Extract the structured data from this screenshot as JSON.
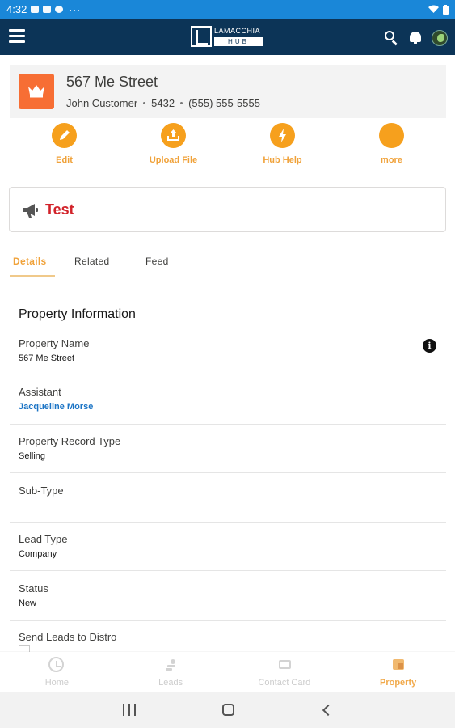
{
  "status_bar": {
    "time": "4:32",
    "overflow": "···"
  },
  "app_bar": {
    "logo_top": "LAMACCHIA",
    "logo_bottom": "HUB",
    "icons": [
      "menu-icon",
      "search-icon",
      "bell-icon",
      "avatar"
    ]
  },
  "record": {
    "title": "567 Me Street",
    "contact": "John Customer",
    "number": "5432",
    "phone": "(555) 555-5555",
    "icon": "crown-icon",
    "icon_color": "#f76e34"
  },
  "actions": [
    {
      "label": "Edit",
      "icon": "pencil-icon"
    },
    {
      "label": "Upload File",
      "icon": "upload-icon"
    },
    {
      "label": "Hub Help",
      "icon": "lightning-icon"
    },
    {
      "label": "more",
      "icon": ""
    }
  ],
  "notice": {
    "text": "Test",
    "icon": "megaphone-icon",
    "color": "#d2232a"
  },
  "tabs": [
    {
      "label": "Details",
      "active": true
    },
    {
      "label": "Related",
      "active": false
    },
    {
      "label": "Feed",
      "active": false
    }
  ],
  "section": {
    "title": "Property Information"
  },
  "fields": [
    {
      "label": "Property Name",
      "value": "567 Me Street"
    },
    {
      "label": "Assistant",
      "value": "Jacqueline Morse"
    },
    {
      "label": "Property Record Type",
      "value": "Selling"
    },
    {
      "label": "Sub-Type",
      "value": ""
    },
    {
      "label": "Lead Type",
      "value": "Company"
    },
    {
      "label": "Status",
      "value": "New"
    },
    {
      "label": "Send Leads to Distro",
      "value": ""
    }
  ],
  "bottom_nav": [
    {
      "label": "Home",
      "icon": "clock-icon",
      "active": false
    },
    {
      "label": "Leads",
      "icon": "leads-icon",
      "active": false
    },
    {
      "label": "Contact Card",
      "icon": "card-icon",
      "active": false
    },
    {
      "label": "Property",
      "icon": "property-icon",
      "active": true
    }
  ],
  "colors": {
    "accent": "#f6a01d",
    "header": "#0c3457",
    "status_bar": "#1a87d8",
    "link": "#1b74c5"
  }
}
